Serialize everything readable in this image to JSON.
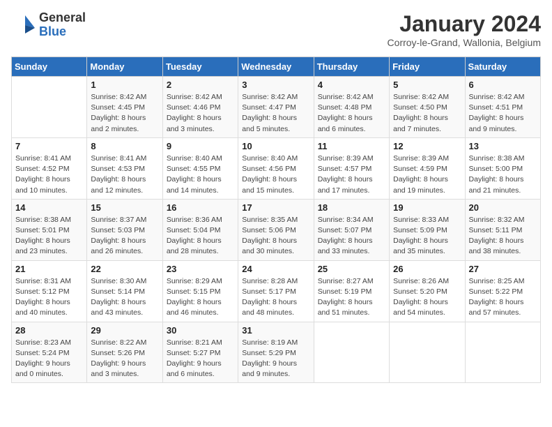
{
  "header": {
    "logo_general": "General",
    "logo_blue": "Blue",
    "month_title": "January 2024",
    "subtitle": "Corroy-le-Grand, Wallonia, Belgium"
  },
  "weekdays": [
    "Sunday",
    "Monday",
    "Tuesday",
    "Wednesday",
    "Thursday",
    "Friday",
    "Saturday"
  ],
  "weeks": [
    [
      {
        "day": "",
        "info": ""
      },
      {
        "day": "1",
        "info": "Sunrise: 8:42 AM\nSunset: 4:45 PM\nDaylight: 8 hours\nand 2 minutes."
      },
      {
        "day": "2",
        "info": "Sunrise: 8:42 AM\nSunset: 4:46 PM\nDaylight: 8 hours\nand 3 minutes."
      },
      {
        "day": "3",
        "info": "Sunrise: 8:42 AM\nSunset: 4:47 PM\nDaylight: 8 hours\nand 5 minutes."
      },
      {
        "day": "4",
        "info": "Sunrise: 8:42 AM\nSunset: 4:48 PM\nDaylight: 8 hours\nand 6 minutes."
      },
      {
        "day": "5",
        "info": "Sunrise: 8:42 AM\nSunset: 4:50 PM\nDaylight: 8 hours\nand 7 minutes."
      },
      {
        "day": "6",
        "info": "Sunrise: 8:42 AM\nSunset: 4:51 PM\nDaylight: 8 hours\nand 9 minutes."
      }
    ],
    [
      {
        "day": "7",
        "info": "Sunrise: 8:41 AM\nSunset: 4:52 PM\nDaylight: 8 hours\nand 10 minutes."
      },
      {
        "day": "8",
        "info": "Sunrise: 8:41 AM\nSunset: 4:53 PM\nDaylight: 8 hours\nand 12 minutes."
      },
      {
        "day": "9",
        "info": "Sunrise: 8:40 AM\nSunset: 4:55 PM\nDaylight: 8 hours\nand 14 minutes."
      },
      {
        "day": "10",
        "info": "Sunrise: 8:40 AM\nSunset: 4:56 PM\nDaylight: 8 hours\nand 15 minutes."
      },
      {
        "day": "11",
        "info": "Sunrise: 8:39 AM\nSunset: 4:57 PM\nDaylight: 8 hours\nand 17 minutes."
      },
      {
        "day": "12",
        "info": "Sunrise: 8:39 AM\nSunset: 4:59 PM\nDaylight: 8 hours\nand 19 minutes."
      },
      {
        "day": "13",
        "info": "Sunrise: 8:38 AM\nSunset: 5:00 PM\nDaylight: 8 hours\nand 21 minutes."
      }
    ],
    [
      {
        "day": "14",
        "info": "Sunrise: 8:38 AM\nSunset: 5:01 PM\nDaylight: 8 hours\nand 23 minutes."
      },
      {
        "day": "15",
        "info": "Sunrise: 8:37 AM\nSunset: 5:03 PM\nDaylight: 8 hours\nand 26 minutes."
      },
      {
        "day": "16",
        "info": "Sunrise: 8:36 AM\nSunset: 5:04 PM\nDaylight: 8 hours\nand 28 minutes."
      },
      {
        "day": "17",
        "info": "Sunrise: 8:35 AM\nSunset: 5:06 PM\nDaylight: 8 hours\nand 30 minutes."
      },
      {
        "day": "18",
        "info": "Sunrise: 8:34 AM\nSunset: 5:07 PM\nDaylight: 8 hours\nand 33 minutes."
      },
      {
        "day": "19",
        "info": "Sunrise: 8:33 AM\nSunset: 5:09 PM\nDaylight: 8 hours\nand 35 minutes."
      },
      {
        "day": "20",
        "info": "Sunrise: 8:32 AM\nSunset: 5:11 PM\nDaylight: 8 hours\nand 38 minutes."
      }
    ],
    [
      {
        "day": "21",
        "info": "Sunrise: 8:31 AM\nSunset: 5:12 PM\nDaylight: 8 hours\nand 40 minutes."
      },
      {
        "day": "22",
        "info": "Sunrise: 8:30 AM\nSunset: 5:14 PM\nDaylight: 8 hours\nand 43 minutes."
      },
      {
        "day": "23",
        "info": "Sunrise: 8:29 AM\nSunset: 5:15 PM\nDaylight: 8 hours\nand 46 minutes."
      },
      {
        "day": "24",
        "info": "Sunrise: 8:28 AM\nSunset: 5:17 PM\nDaylight: 8 hours\nand 48 minutes."
      },
      {
        "day": "25",
        "info": "Sunrise: 8:27 AM\nSunset: 5:19 PM\nDaylight: 8 hours\nand 51 minutes."
      },
      {
        "day": "26",
        "info": "Sunrise: 8:26 AM\nSunset: 5:20 PM\nDaylight: 8 hours\nand 54 minutes."
      },
      {
        "day": "27",
        "info": "Sunrise: 8:25 AM\nSunset: 5:22 PM\nDaylight: 8 hours\nand 57 minutes."
      }
    ],
    [
      {
        "day": "28",
        "info": "Sunrise: 8:23 AM\nSunset: 5:24 PM\nDaylight: 9 hours\nand 0 minutes."
      },
      {
        "day": "29",
        "info": "Sunrise: 8:22 AM\nSunset: 5:26 PM\nDaylight: 9 hours\nand 3 minutes."
      },
      {
        "day": "30",
        "info": "Sunrise: 8:21 AM\nSunset: 5:27 PM\nDaylight: 9 hours\nand 6 minutes."
      },
      {
        "day": "31",
        "info": "Sunrise: 8:19 AM\nSunset: 5:29 PM\nDaylight: 9 hours\nand 9 minutes."
      },
      {
        "day": "",
        "info": ""
      },
      {
        "day": "",
        "info": ""
      },
      {
        "day": "",
        "info": ""
      }
    ]
  ]
}
